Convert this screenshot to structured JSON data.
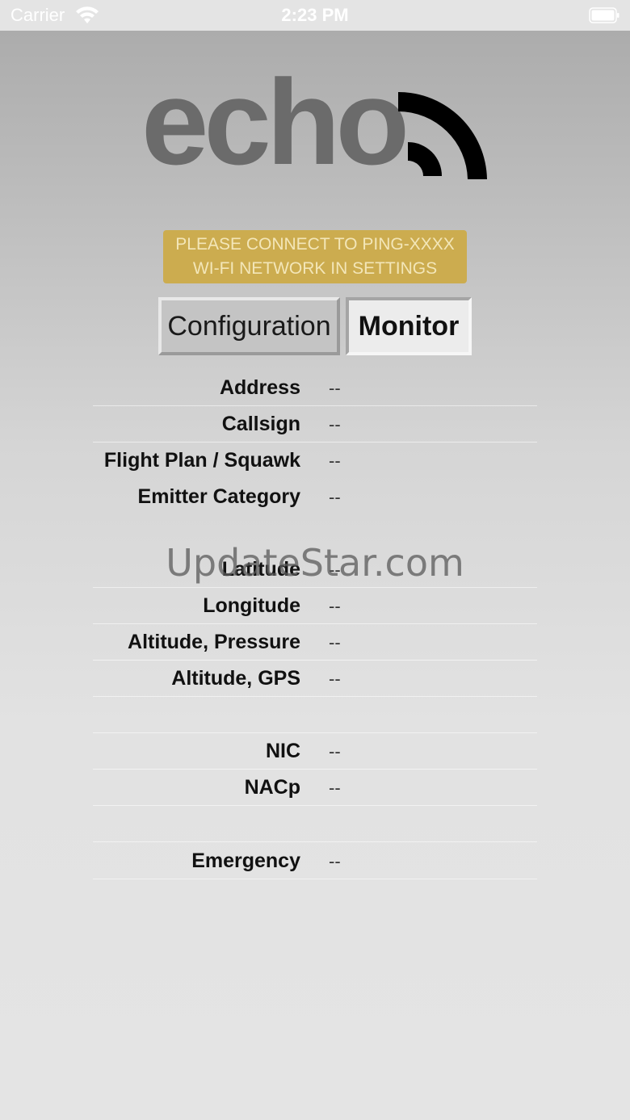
{
  "status_bar": {
    "carrier": "Carrier",
    "time": "2:23 PM"
  },
  "logo": {
    "text": "echo"
  },
  "banner": {
    "line1": "PLEASE CONNECT TO PING-XXXX",
    "line2": "WI-FI NETWORK IN SETTINGS"
  },
  "tabs": {
    "configuration": "Configuration",
    "monitor": "Monitor",
    "selected": "Monitor"
  },
  "fields": [
    {
      "label": "Address",
      "value": "--"
    },
    {
      "label": "Callsign",
      "value": "--"
    },
    {
      "label": "Flight Plan / Squawk",
      "value": "--"
    },
    {
      "label": "Emitter Category",
      "value": "--"
    },
    {
      "label": "Latitude",
      "value": "--"
    },
    {
      "label": "Longitude",
      "value": "--"
    },
    {
      "label": "Altitude, Pressure",
      "value": "--"
    },
    {
      "label": "Altitude, GPS",
      "value": "--"
    },
    {
      "label": "NIC",
      "value": "--"
    },
    {
      "label": "NACp",
      "value": "--"
    },
    {
      "label": "Emergency",
      "value": "--"
    }
  ],
  "watermark": "UpdateStar.com",
  "colors": {
    "banner": "#ccac4f",
    "logo_gray": "#6b6b6b",
    "signal": "#000000"
  }
}
